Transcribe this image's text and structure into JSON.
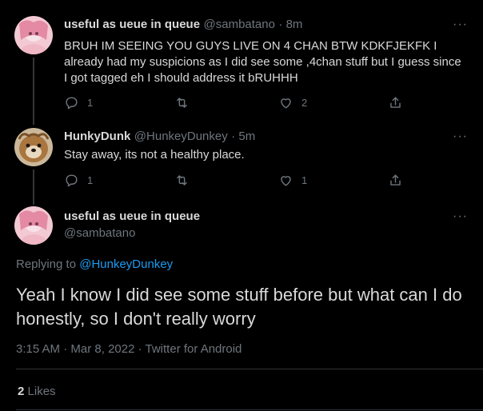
{
  "tweet1": {
    "display_name": "useful as ueue in queue",
    "handle": "@sambatano",
    "time": "· 8m",
    "text": "BRUH IM SEEING YOU GUYS LIVE ON 4 CHAN BTW KDKFJEKFK I already had my suspicions as I did see some ,4chan stuff but I guess since I got tagged eh I should address it bRUHHH",
    "replies": "1",
    "retweets": "",
    "likes": "2"
  },
  "tweet2": {
    "display_name": "HunkyDunk",
    "handle": "@HunkeyDunkey",
    "time": "· 5m",
    "text": "Stay away, its not a healthy place.",
    "replies": "1",
    "retweets": "",
    "likes": "1"
  },
  "main_tweet": {
    "display_name": "useful as ueue in queue",
    "handle": "@sambatano",
    "replying_label": "Replying to",
    "replying_to": "@HunkeyDunkey",
    "text": "Yeah I know I did see some stuff before but what can I do honestly, so I don't really worry",
    "time": "3:15 AM",
    "date": "Mar 8, 2022",
    "source": "Twitter for Android",
    "likes_count": "2",
    "likes_label": "Likes"
  },
  "ui": {
    "more_glyph": "···",
    "dot_sep": "·"
  },
  "colors": {
    "background": "#000000",
    "text": "#d9d9d9",
    "muted": "#6e767d",
    "link": "#1d9bf0",
    "divider": "#2f3336"
  },
  "icons": [
    "reply-icon",
    "retweet-icon",
    "like-icon",
    "share-icon",
    "more-icon"
  ]
}
